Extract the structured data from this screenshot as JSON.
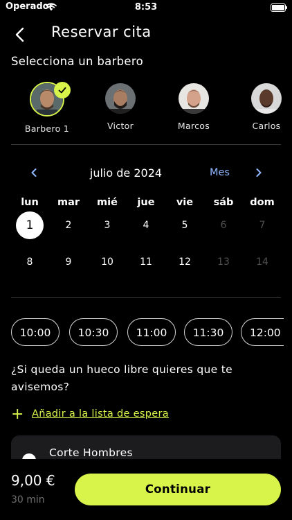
{
  "status_bar": {
    "carrier": "Operador",
    "time": "8:53"
  },
  "header": {
    "title": "Reservar cita"
  },
  "barbers_section": {
    "title": "Selecciona un barbero",
    "barbers": [
      {
        "name": "Barbero 1",
        "selected": true
      },
      {
        "name": "Victor",
        "selected": false
      },
      {
        "name": "Marcos",
        "selected": false
      },
      {
        "name": "Carlos",
        "selected": false
      }
    ]
  },
  "calendar": {
    "month_label": "julio de 2024",
    "view_mode": "Mes",
    "weekdays": [
      "lun",
      "mar",
      "mié",
      "jue",
      "vie",
      "sáb",
      "dom"
    ],
    "weeks": [
      [
        "1",
        "2",
        "3",
        "4",
        "5",
        "6",
        "7"
      ],
      [
        "8",
        "9",
        "10",
        "11",
        "12",
        "13",
        "14"
      ]
    ],
    "selected_day": "1",
    "unavailable_days": [
      "6",
      "7",
      "13",
      "14"
    ]
  },
  "time_slots": [
    "10:00",
    "10:30",
    "11:00",
    "11:30",
    "12:00"
  ],
  "waitlist": {
    "question": "¿Si queda un hueco libre quieres que te avisemos?",
    "link": "Añadir a la lista de espera"
  },
  "service": {
    "name": "Corte Hombres"
  },
  "footer": {
    "price": "9,00 €",
    "duration": "30 min",
    "continue_label": "Continuar"
  },
  "colors": {
    "accent": "#d8f34a",
    "link_blue": "#8fb7ff",
    "background": "#000000"
  }
}
